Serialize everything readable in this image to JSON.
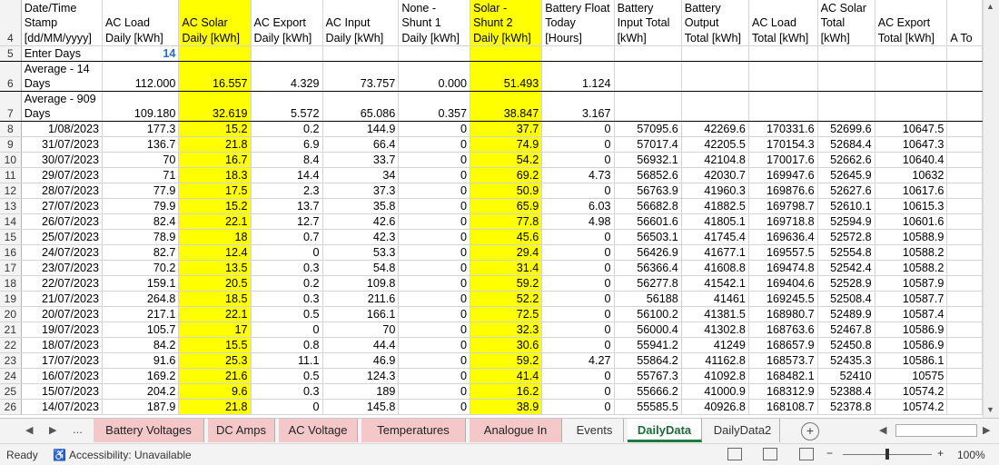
{
  "columns": [
    "Date/Time Stamp [dd/MM/yyyy]",
    "AC Load Daily [kWh]",
    "AC Solar Daily [kWh]",
    "AC Export Daily [kWh]",
    "AC Input Daily [kWh]",
    "None - Shunt 1 Daily [kWh]",
    "Solar - Shunt 2 Daily [kWh]",
    "Battery Float Today [Hours]",
    "Battery Input Total [kWh]",
    "Battery Output Total [kWh]",
    "AC Load Total [kWh]",
    "AC Solar Total [kWh]",
    "AC Export Total [kWh]",
    "A To"
  ],
  "highlight_color": "#ffff00",
  "row5": {
    "rownum": "5",
    "label": "Enter Days",
    "value": "14"
  },
  "summary": [
    {
      "rownum": "6",
      "label": "Average - 14 Days",
      "values": [
        "112.000",
        "16.557",
        "4.329",
        "73.757",
        "0.000",
        "51.493",
        "1.124"
      ]
    },
    {
      "rownum": "7",
      "label": "Average - 909 Days",
      "values": [
        "109.180",
        "32.619",
        "5.572",
        "65.086",
        "0.357",
        "38.847",
        "3.167"
      ]
    }
  ],
  "header_rownum": "4",
  "rows": [
    {
      "rownum": "8",
      "cells": [
        "1/08/2023",
        "177.3",
        "15.2",
        "0.2",
        "144.9",
        "0",
        "37.7",
        "0",
        "57095.6",
        "42269.6",
        "170331.6",
        "52699.6",
        "10647.5"
      ]
    },
    {
      "rownum": "9",
      "cells": [
        "31/07/2023",
        "136.7",
        "21.8",
        "6.9",
        "66.4",
        "0",
        "74.9",
        "0",
        "57017.4",
        "42205.5",
        "170154.3",
        "52684.4",
        "10647.3"
      ]
    },
    {
      "rownum": "10",
      "cells": [
        "30/07/2023",
        "70",
        "16.7",
        "8.4",
        "33.7",
        "0",
        "54.2",
        "0",
        "56932.1",
        "42104.8",
        "170017.6",
        "52662.6",
        "10640.4"
      ]
    },
    {
      "rownum": "11",
      "cells": [
        "29/07/2023",
        "71",
        "18.3",
        "14.4",
        "34",
        "0",
        "69.2",
        "4.73",
        "56852.6",
        "42030.7",
        "169947.6",
        "52645.9",
        "10632"
      ]
    },
    {
      "rownum": "12",
      "cells": [
        "28/07/2023",
        "77.9",
        "17.5",
        "2.3",
        "37.3",
        "0",
        "50.9",
        "0",
        "56763.9",
        "41960.3",
        "169876.6",
        "52627.6",
        "10617.6"
      ]
    },
    {
      "rownum": "13",
      "cells": [
        "27/07/2023",
        "79.9",
        "15.2",
        "13.7",
        "35.8",
        "0",
        "65.9",
        "6.03",
        "56682.8",
        "41882.5",
        "169798.7",
        "52610.1",
        "10615.3"
      ]
    },
    {
      "rownum": "14",
      "cells": [
        "26/07/2023",
        "82.4",
        "22.1",
        "12.7",
        "42.6",
        "0",
        "77.8",
        "4.98",
        "56601.6",
        "41805.1",
        "169718.8",
        "52594.9",
        "10601.6"
      ]
    },
    {
      "rownum": "15",
      "cells": [
        "25/07/2023",
        "78.9",
        "18",
        "0.7",
        "42.3",
        "0",
        "45.6",
        "0",
        "56503.1",
        "41745.4",
        "169636.4",
        "52572.8",
        "10588.9"
      ]
    },
    {
      "rownum": "16",
      "cells": [
        "24/07/2023",
        "82.7",
        "12.4",
        "0",
        "53.3",
        "0",
        "29.4",
        "0",
        "56426.9",
        "41677.1",
        "169557.5",
        "52554.8",
        "10588.2"
      ]
    },
    {
      "rownum": "17",
      "cells": [
        "23/07/2023",
        "70.2",
        "13.5",
        "0.3",
        "54.8",
        "0",
        "31.4",
        "0",
        "56366.4",
        "41608.8",
        "169474.8",
        "52542.4",
        "10588.2"
      ]
    },
    {
      "rownum": "18",
      "cells": [
        "22/07/2023",
        "159.1",
        "20.5",
        "0.2",
        "109.8",
        "0",
        "59.2",
        "0",
        "56277.8",
        "41542.1",
        "169404.6",
        "52528.9",
        "10587.9"
      ]
    },
    {
      "rownum": "19",
      "cells": [
        "21/07/2023",
        "264.8",
        "18.5",
        "0.3",
        "211.6",
        "0",
        "52.2",
        "0",
        "56188",
        "41461",
        "169245.5",
        "52508.4",
        "10587.7"
      ]
    },
    {
      "rownum": "20",
      "cells": [
        "20/07/2023",
        "217.1",
        "22.1",
        "0.5",
        "166.1",
        "0",
        "72.5",
        "0",
        "56100.2",
        "41381.5",
        "168980.7",
        "52489.9",
        "10587.4"
      ]
    },
    {
      "rownum": "21",
      "cells": [
        "19/07/2023",
        "105.7",
        "17",
        "0",
        "70",
        "0",
        "32.3",
        "0",
        "56000.4",
        "41302.8",
        "168763.6",
        "52467.8",
        "10586.9"
      ]
    },
    {
      "rownum": "22",
      "cells": [
        "18/07/2023",
        "84.2",
        "15.5",
        "0.8",
        "44.4",
        "0",
        "30.6",
        "0",
        "55941.2",
        "41249",
        "168657.9",
        "52450.8",
        "10586.9"
      ]
    },
    {
      "rownum": "23",
      "cells": [
        "17/07/2023",
        "91.6",
        "25.3",
        "11.1",
        "46.9",
        "0",
        "59.2",
        "4.27",
        "55864.2",
        "41162.8",
        "168573.7",
        "52435.3",
        "10586.1"
      ]
    },
    {
      "rownum": "24",
      "cells": [
        "16/07/2023",
        "169.2",
        "21.6",
        "0.5",
        "124.3",
        "0",
        "41.4",
        "0",
        "55767.3",
        "41092.8",
        "168482.1",
        "52410",
        "10575"
      ]
    },
    {
      "rownum": "25",
      "cells": [
        "15/07/2023",
        "204.2",
        "9.6",
        "0.3",
        "189",
        "0",
        "16.2",
        "0",
        "55666.2",
        "41000.9",
        "168312.9",
        "52388.4",
        "10574.2"
      ]
    },
    {
      "rownum": "26",
      "cells": [
        "14/07/2023",
        "187.9",
        "21.8",
        "0",
        "145.8",
        "0",
        "38.9",
        "0",
        "55585.5",
        "40926.8",
        "168108.7",
        "52378.8",
        "10574.2"
      ]
    }
  ],
  "tabs": {
    "ellipsis": "...",
    "items": [
      {
        "label": "Battery Voltages",
        "style": "pink"
      },
      {
        "label": "DC Amps",
        "style": "pink"
      },
      {
        "label": "AC Voltage",
        "style": "pink"
      },
      {
        "label": "Temperatures",
        "style": "pink"
      },
      {
        "label": "Analogue In",
        "style": "pink"
      },
      {
        "label": "Events",
        "style": "plain"
      },
      {
        "label": "DailyData",
        "style": "active"
      },
      {
        "label": "DailyData2",
        "style": "plain"
      }
    ],
    "add": "+"
  },
  "status": {
    "ready": "Ready",
    "accessibility": "Accessibility: Unavailable",
    "zoom": "100%"
  }
}
